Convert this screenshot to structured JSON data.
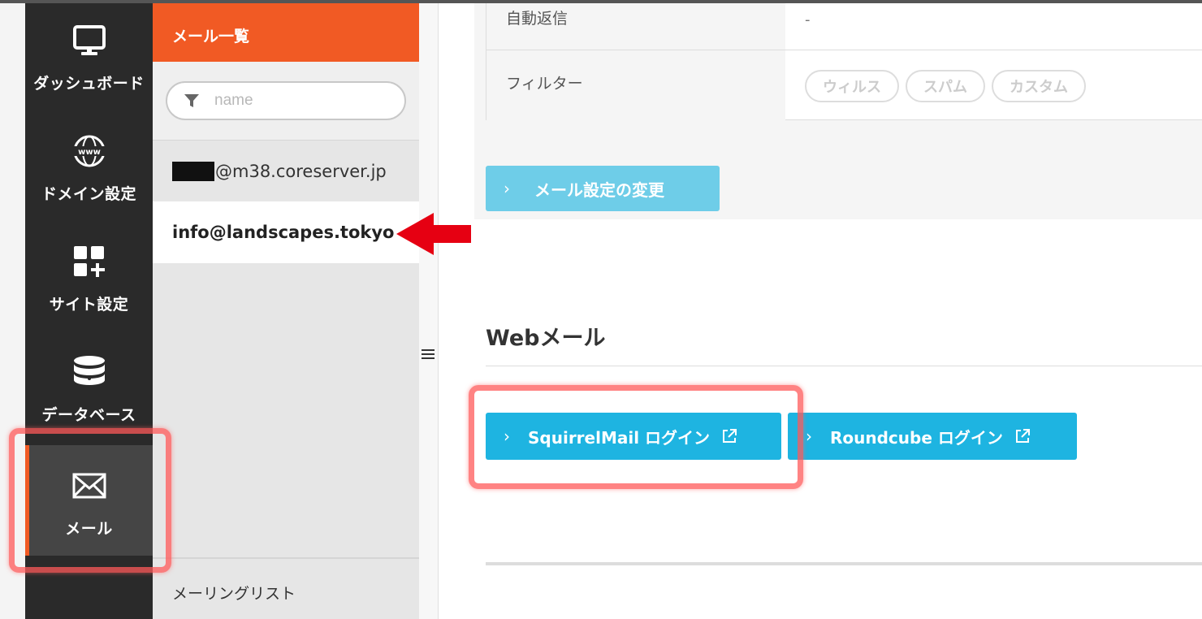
{
  "nav": {
    "items": [
      {
        "label": "ダッシュボード",
        "icon": "monitor-icon"
      },
      {
        "label": "ドメイン設定",
        "icon": "globe-www-icon"
      },
      {
        "label": "サイト設定",
        "icon": "grid-plus-icon"
      },
      {
        "label": "データベース",
        "icon": "database-icon"
      },
      {
        "label": "メール",
        "icon": "envelope-icon",
        "active": true
      }
    ]
  },
  "mail_list": {
    "header": "メール一覧",
    "filter_placeholder": "name",
    "accounts": [
      {
        "address": "@m38.coreserver.jp",
        "redacted_prefix": true
      },
      {
        "address": "info@landscapes.tokyo",
        "selected": true
      }
    ],
    "mailing_list_label": "メーリングリスト"
  },
  "settings": {
    "auto_reply_label": "自動返信",
    "auto_reply_value": "-",
    "filter_label": "フィルター",
    "filter_tags": [
      "ウィルス",
      "スパム",
      "カスタム"
    ],
    "change_button": "メール設定の変更"
  },
  "webmail": {
    "title": "Webメール",
    "squirrelmail_button": "SquirrelMail ログイン",
    "roundcube_button": "Roundcube ログイン"
  },
  "colors": {
    "accent": "#f15a24",
    "button": "#1eb4e1",
    "button_light": "#6ecde8",
    "nav_bg": "#2a2a2a",
    "annotation": "#ff5a5a",
    "arrow": "#e60012"
  }
}
